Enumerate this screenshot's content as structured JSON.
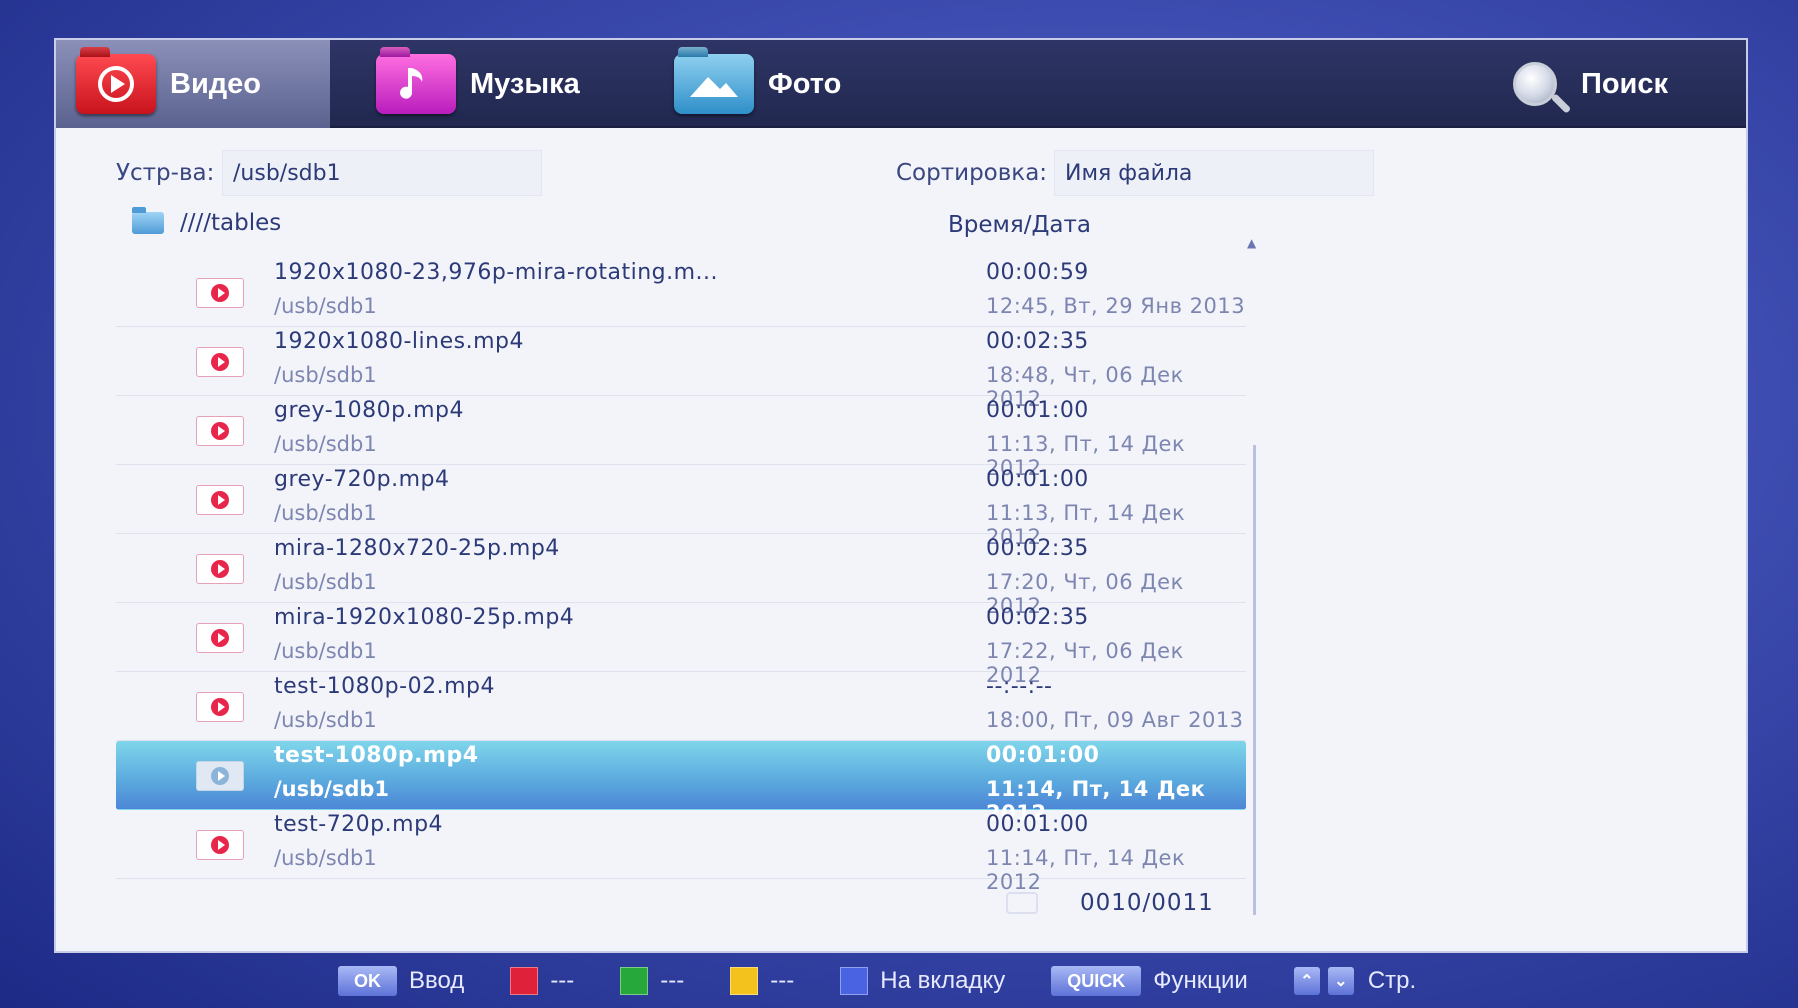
{
  "tabs": [
    {
      "label": "Видео",
      "icon": "video-play-icon",
      "active": true
    },
    {
      "label": "Музыка",
      "icon": "music-note-icon",
      "active": false
    },
    {
      "label": "Фото",
      "icon": "photo-mountain-icon",
      "active": false
    }
  ],
  "search": {
    "label": "Поиск",
    "icon": "magnifier-icon"
  },
  "device": {
    "label": "Устр-ва:",
    "value": "/usb/sdb1"
  },
  "sort": {
    "label": "Сортировка:",
    "value": "Имя файла"
  },
  "folder": {
    "path": "////tables",
    "icon": "folder-icon"
  },
  "column_header": "Время/Дата",
  "files": [
    {
      "name": "1920x1080-23,976p-mira-rotating.m...",
      "path": "/usb/sdb1",
      "duration": "00:00:59",
      "date": "12:45, Вт, 29 Янв 2013",
      "selected": false
    },
    {
      "name": "1920x1080-lines.mp4",
      "path": "/usb/sdb1",
      "duration": "00:02:35",
      "date": "18:48, Чт, 06 Дек 2012",
      "selected": false
    },
    {
      "name": "grey-1080p.mp4",
      "path": "/usb/sdb1",
      "duration": "00:01:00",
      "date": "11:13, Пт, 14 Дек 2012",
      "selected": false
    },
    {
      "name": "grey-720p.mp4",
      "path": "/usb/sdb1",
      "duration": "00:01:00",
      "date": "11:13, Пт, 14 Дек 2012",
      "selected": false
    },
    {
      "name": "mira-1280x720-25p.mp4",
      "path": "/usb/sdb1",
      "duration": "00:02:35",
      "date": "17:20, Чт, 06 Дек 2012",
      "selected": false
    },
    {
      "name": "mira-1920x1080-25p.mp4",
      "path": "/usb/sdb1",
      "duration": "00:02:35",
      "date": "17:22, Чт, 06 Дек 2012",
      "selected": false
    },
    {
      "name": "test-1080p-02.mp4",
      "path": "/usb/sdb1",
      "duration": "--:--:--",
      "date": "18:00, Пт, 09 Авг 2013",
      "selected": false
    },
    {
      "name": "test-1080p.mp4",
      "path": "/usb/sdb1",
      "duration": "00:01:00",
      "date": "11:14, Пт, 14 Дек 2012",
      "selected": true
    },
    {
      "name": "test-720p.mp4",
      "path": "/usb/sdb1",
      "duration": "00:01:00",
      "date": "11:14, Пт, 14 Дек 2012",
      "selected": false
    }
  ],
  "counter": "0010/0011",
  "legend": {
    "ok_key": "OK",
    "ok_text": "Ввод",
    "red_text": "---",
    "green_text": "---",
    "yellow_text": "---",
    "blue_text": "На вкладку",
    "quick_key": "QUICK",
    "quick_text": "Функции",
    "page_text": "Стр."
  },
  "colors": {
    "red": "#e0213a",
    "green": "#27a83b",
    "yellow": "#f3c21c",
    "blue": "#4a63e2",
    "selected_row": "#5aa8de"
  }
}
